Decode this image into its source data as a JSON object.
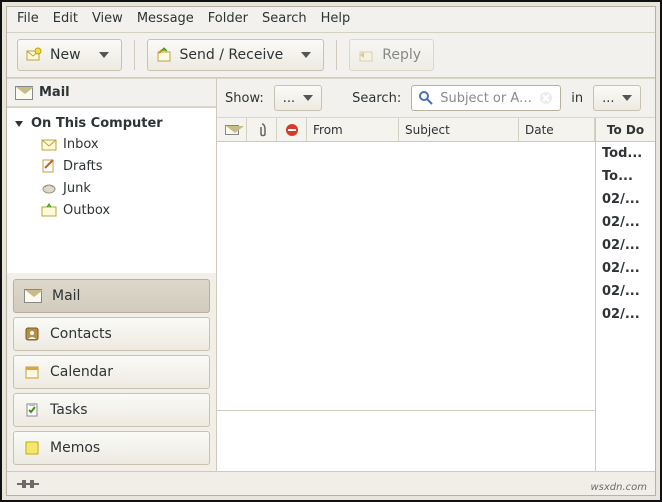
{
  "menu": [
    "File",
    "Edit",
    "View",
    "Message",
    "Folder",
    "Search",
    "Help"
  ],
  "toolbar": {
    "new": "New",
    "sendreceive": "Send / Receive",
    "reply": "Reply"
  },
  "sidebar": {
    "section": "Mail",
    "root": "On This Computer",
    "folders": [
      "Inbox",
      "Drafts",
      "Junk",
      "Outbox"
    ],
    "modules": [
      "Mail",
      "Contacts",
      "Calendar",
      "Tasks",
      "Memos"
    ],
    "active_module": "Mail"
  },
  "filter": {
    "show_label": "Show:",
    "show_value": "...",
    "search_label": "Search:",
    "search_placeholder": "Subject or Ad...",
    "in_label": "in",
    "in_value": "..."
  },
  "columns": {
    "from": "From",
    "subject": "Subject",
    "date": "Date"
  },
  "todo": {
    "header": "To Do",
    "items": [
      "Tod...",
      "To...",
      "02/...",
      "02/...",
      "02/...",
      "02/...",
      "02/...",
      "02/..."
    ]
  },
  "watermark": "wsxdn.com"
}
